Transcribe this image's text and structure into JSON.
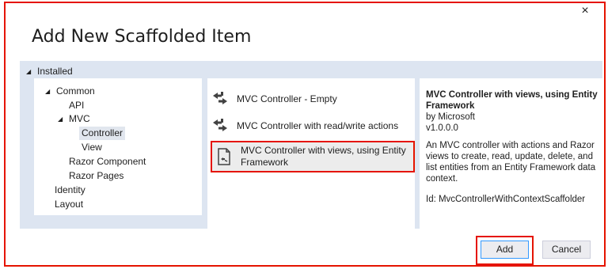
{
  "dialog": {
    "title": "Add New Scaffolded Item",
    "close_glyph": "×"
  },
  "tree": {
    "root_label": "Installed",
    "items": [
      {
        "label": "Common",
        "expanded": true
      },
      {
        "label": "API"
      },
      {
        "label": "MVC",
        "expanded": true
      },
      {
        "label": "Controller",
        "selected": true
      },
      {
        "label": "View"
      },
      {
        "label": "Razor Component"
      },
      {
        "label": "Razor Pages"
      },
      {
        "label": "Identity"
      },
      {
        "label": "Layout"
      }
    ]
  },
  "templates": [
    {
      "label": "MVC Controller - Empty",
      "icon": "controller-arrows-icon"
    },
    {
      "label": "MVC Controller with read/write actions",
      "icon": "controller-arrows-icon"
    },
    {
      "label": "MVC Controller with views, using Entity Framework",
      "icon": "document-scaffold-icon",
      "selected": true
    }
  ],
  "details": {
    "title": "MVC Controller with views, using Entity Framework",
    "author": "by Microsoft",
    "version": "v1.0.0.0",
    "description": "An MVC controller with actions and Razor views to create, read, update, delete, and list entities from an Entity Framework data context.",
    "id_line": "Id: MvcControllerWithContextScaffolder"
  },
  "buttons": {
    "add": "Add",
    "cancel": "Cancel"
  },
  "colors": {
    "highlight": "#e51400",
    "panel_bg": "#dde5f1",
    "selected_tree_bg": "#e1e6ee"
  }
}
